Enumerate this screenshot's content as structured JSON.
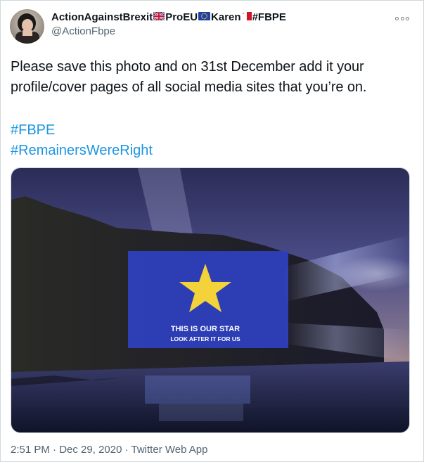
{
  "user": {
    "display_name_start": "ActionAgainstBrexit",
    "display_name_mid1": "ProEU",
    "display_name_mid2": "Karen",
    "display_name_end": "#FBPE",
    "handle": "@ActionFbpe"
  },
  "tweet": {
    "text": "Please save this photo and on 31st December add it your profile/cover pages of all social media sites that you’re on.",
    "hashtags": [
      "#FBPE",
      "#RemainersWereRight"
    ]
  },
  "media": {
    "projection_line1": "THIS IS OUR STAR",
    "projection_line2": "LOOK AFTER IT FOR US"
  },
  "meta": {
    "time": "2:51 PM",
    "separator": " · ",
    "date": "Dec 29, 2020",
    "source": "Twitter Web App"
  },
  "colors": {
    "link": "#1b95e0",
    "secondary_text": "#536471",
    "eu_blue": "#2a3bb5",
    "star_yellow": "#f3d23a"
  },
  "icons": {
    "avatar": "profile-photo",
    "flag_uk": "uk-flag-emoji",
    "flag_eu": "eu-flag-emoji",
    "flag_mt": "malta-flag-emoji",
    "more": "more-options-icon"
  }
}
